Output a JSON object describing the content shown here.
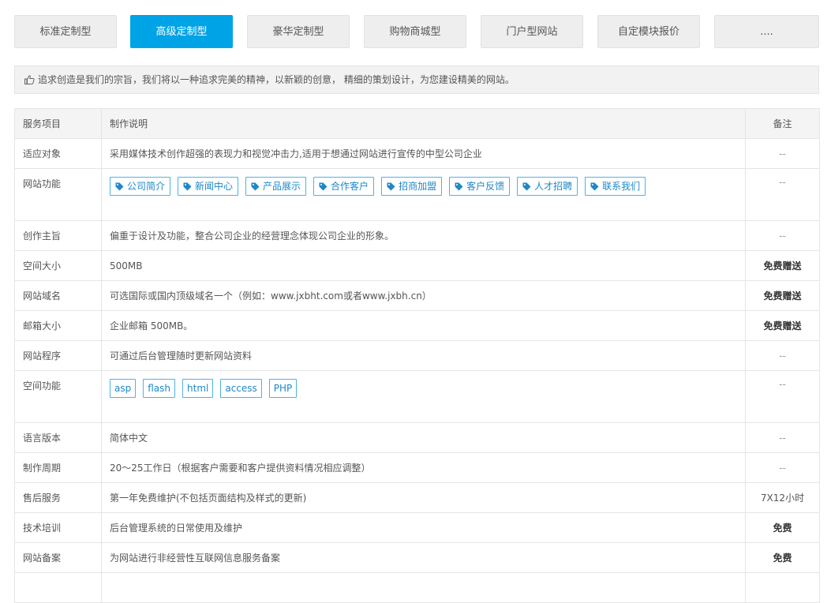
{
  "tabs": [
    "标准定制型",
    "高级定制型",
    "豪华定制型",
    "购物商城型",
    "门户型网站",
    "自定模块报价",
    "...."
  ],
  "active_tab": 1,
  "notice": "追求创造是我们的宗旨，我们将以一种追求完美的精神，以新颖的创意， 精细的策划设计，为您建设精美的网站。",
  "table": {
    "headers": [
      "服务项目",
      "制作说明",
      "备注"
    ],
    "rows": [
      {
        "item": "适应对象",
        "desc": "采用媒体技术创作超强的表现力和视觉冲击力,适用于想通过网站进行宣传的中型公司企业",
        "note": "--"
      },
      {
        "item": "网站功能",
        "tags": [
          "公司简介",
          "新闻中心",
          "产品展示",
          "合作客户",
          "招商加盟",
          "客户反馈",
          "人才招聘",
          "联系我们"
        ],
        "note": "--"
      },
      {
        "item": "创作主旨",
        "desc": "偏重于设计及功能，整合公司企业的经营理念体现公司企业的形象。",
        "note": "--"
      },
      {
        "item": "空间大小",
        "desc": "500MB",
        "note": "免费赠送"
      },
      {
        "item": "网站域名",
        "desc": "可选国际或国内顶级域名一个（例如：www.jxbht.com或者www.jxbh.cn）",
        "note": "免费赠送"
      },
      {
        "item": "邮箱大小",
        "desc": "企业邮箱 500MB。",
        "note": "免费赠送"
      },
      {
        "item": "网站程序",
        "desc": "可通过后台管理随时更新网站资料",
        "note": "--"
      },
      {
        "item": "空间功能",
        "plain_tags": [
          "asp",
          "flash",
          "html",
          "access",
          "PHP"
        ],
        "note": "--"
      },
      {
        "item": "语言版本",
        "desc": "简体中文",
        "note": "--"
      },
      {
        "item": "制作周期",
        "desc": "20～25工作日（根据客户需要和客户提供资料情况相应调整）",
        "note": "--"
      },
      {
        "item": "售后服务",
        "desc": "第一年免费维护(不包括页面结构及样式的更新)",
        "note": "7X12小时"
      },
      {
        "item": "技术培训",
        "desc": "后台管理系统的日常使用及维护",
        "note": "免费"
      },
      {
        "item": "网站备案",
        "desc": "为网站进行非经营性互联网信息服务备案",
        "note": "免费"
      },
      {
        "item": "",
        "desc": "",
        "note": ""
      }
    ]
  },
  "colors": {
    "accent": "#00a3e6",
    "tag_border": "#4db3e6",
    "tag_text": "#1e88c9"
  },
  "icons": {
    "notice": "thumbs-up-icon",
    "tag": "tag-icon"
  }
}
